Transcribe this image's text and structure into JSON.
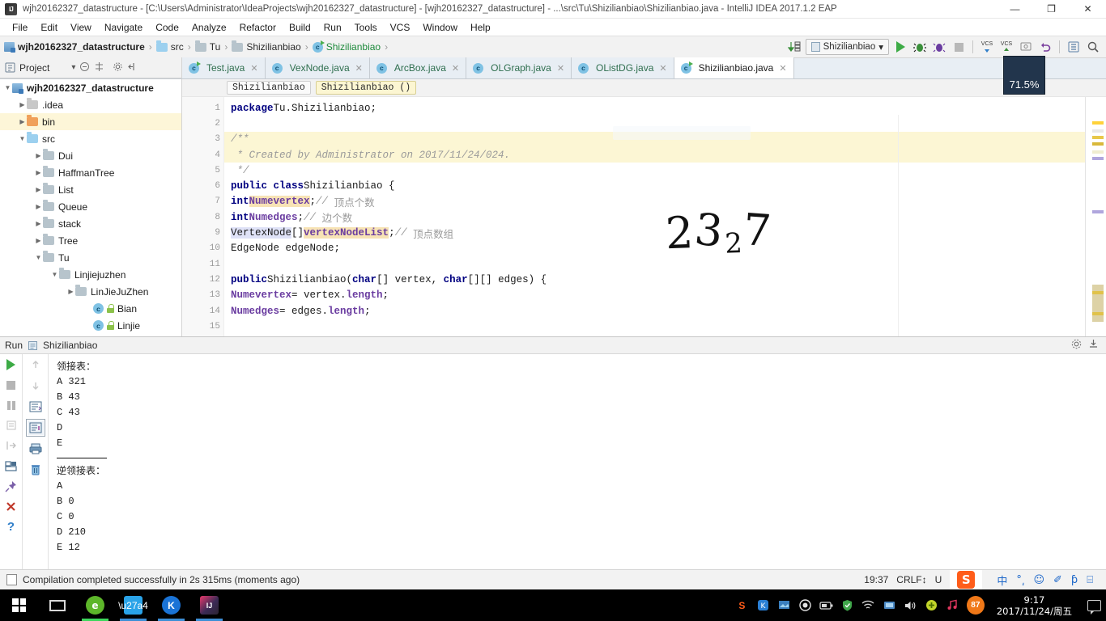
{
  "window": {
    "app_icon": "intellij-idea-icon",
    "title": "wjh20162327_datastructure - [C:\\Users\\Administrator\\IdeaProjects\\wjh20162327_datastructure] - [wjh20162327_datastructure] - ...\\src\\Tu\\Shizilianbiao\\Shizilianbiao.java - IntelliJ IDEA 2017.1.2 EAP",
    "minimize": "—",
    "maximize": "❐",
    "close": "✕"
  },
  "menu": {
    "items": [
      "File",
      "Edit",
      "View",
      "Navigate",
      "Code",
      "Analyze",
      "Refactor",
      "Build",
      "Run",
      "Tools",
      "VCS",
      "Window",
      "Help"
    ]
  },
  "breadcrumb": {
    "items": [
      {
        "label": "wjh20162327_datastructure",
        "icon": "module-icon"
      },
      {
        "label": "src",
        "icon": "source-folder-icon"
      },
      {
        "label": "Tu",
        "icon": "package-icon"
      },
      {
        "label": "Shizilianbiao",
        "icon": "package-icon"
      },
      {
        "label": "Shizilianbiao",
        "icon": "java-class-icon"
      }
    ],
    "separator": "›"
  },
  "toolbar": {
    "update_icon": "update-project-icon",
    "run_config": "Shizilianbiao",
    "run_config_dropdown": "▾",
    "run_button": "run-button",
    "debug_button": "debug-button",
    "coverage_button": "run-with-coverage-button",
    "stop_button": "stop-button",
    "vcs_update_label": "VCS",
    "vcs_commit_label": "VCS",
    "history_icon": "vcs-history-icon",
    "undo_icon": "undo-icon",
    "struct_icon": "structure-icon",
    "search_icon": "search-everywhere-icon"
  },
  "project_panel": {
    "title": "Project",
    "dropdown": "▾",
    "collapse_icon": "collapse-all-icon",
    "target_icon": "scroll-from-source-icon",
    "settings_icon": "gear-icon",
    "hide_icon": "hide-panel-icon",
    "tree": [
      {
        "label": "wjh20162327_datastructure",
        "indent": 0,
        "arrow": "down",
        "icon": "module-icon",
        "bold": true,
        "highlight": false
      },
      {
        "label": ".idea",
        "indent": 1,
        "arrow": "right",
        "icon": "folder-grey-icon",
        "bold": false,
        "highlight": false
      },
      {
        "label": "bin",
        "indent": 1,
        "arrow": "right",
        "icon": "folder-bin-icon",
        "bold": false,
        "highlight": true
      },
      {
        "label": "src",
        "indent": 1,
        "arrow": "down",
        "icon": "source-folder-icon",
        "bold": false,
        "highlight": false
      },
      {
        "label": "Dui",
        "indent": 2,
        "arrow": "right",
        "icon": "package-icon",
        "bold": false,
        "highlight": false
      },
      {
        "label": "HaffmanTree",
        "indent": 2,
        "arrow": "right",
        "icon": "package-icon",
        "bold": false,
        "highlight": false
      },
      {
        "label": "List",
        "indent": 2,
        "arrow": "right",
        "icon": "package-icon",
        "bold": false,
        "highlight": false
      },
      {
        "label": "Queue",
        "indent": 2,
        "arrow": "right",
        "icon": "package-icon",
        "bold": false,
        "highlight": false
      },
      {
        "label": "stack",
        "indent": 2,
        "arrow": "right",
        "icon": "package-icon",
        "bold": false,
        "highlight": false
      },
      {
        "label": "Tree",
        "indent": 2,
        "arrow": "right",
        "icon": "package-icon",
        "bold": false,
        "highlight": false
      },
      {
        "label": "Tu",
        "indent": 2,
        "arrow": "down",
        "icon": "package-icon",
        "bold": false,
        "highlight": false
      },
      {
        "label": "Linjiejuzhen",
        "indent": 3,
        "arrow": "down",
        "icon": "package-icon",
        "bold": false,
        "highlight": false
      },
      {
        "label": "LinJieJuZhen",
        "indent": 4,
        "arrow": "right",
        "icon": "package-icon",
        "bold": false,
        "highlight": false
      },
      {
        "label": "Bian",
        "indent": 5,
        "arrow": "none",
        "icon": "java-class-icon",
        "bold": false,
        "highlight": false
      },
      {
        "label": "Linjie",
        "indent": 5,
        "arrow": "none",
        "icon": "java-class-icon",
        "bold": false,
        "highlight": false
      }
    ]
  },
  "editor_tabs": [
    {
      "label": "Test.java",
      "active": false,
      "icon": "java-runnable-class-icon"
    },
    {
      "label": "VexNode.java",
      "active": false,
      "icon": "java-class-icon"
    },
    {
      "label": "ArcBox.java",
      "active": false,
      "icon": "java-class-icon"
    },
    {
      "label": "OLGraph.java",
      "active": false,
      "icon": "java-class-icon"
    },
    {
      "label": "OListDG.java",
      "active": false,
      "icon": "java-class-icon"
    },
    {
      "label": "Shizilianbiao.java",
      "active": true,
      "icon": "java-runnable-class-icon"
    }
  ],
  "editor": {
    "breadcrumb_chips": [
      {
        "label": "Shizilianbiao",
        "selected": false
      },
      {
        "label": "Shizilianbiao ()",
        "selected": true
      }
    ],
    "line_numbers": [
      "1",
      "2",
      "3",
      "4",
      "5",
      "6",
      "7",
      "8",
      "9",
      "10",
      "11",
      "12",
      "13",
      "14",
      "15"
    ],
    "code_lines": [
      {
        "n": "1",
        "html": "<span class=\"kw\">package</span> <span class=\"ident\">Tu.Shizilianbiao;</span>",
        "comment_bg": false
      },
      {
        "n": "2",
        "html": "",
        "comment_bg": false
      },
      {
        "n": "3",
        "html": "<span class=\"cm\">/**</span>",
        "comment_bg": true
      },
      {
        "n": "4",
        "html": "<span class=\"cm\"> * Created by Administrator on 2017/11/24/024.</span>",
        "comment_bg": true
      },
      {
        "n": "5",
        "html": "<span class=\"cm\"> */</span>",
        "comment_bg": false
      },
      {
        "n": "6",
        "html": "<span class=\"kw\">public class</span> <span class=\"ident\">Shizilianbiao {</span>",
        "comment_bg": false
      },
      {
        "n": "7",
        "html": "    <span class=\"kw\">int</span> <span class=\"fldhl\">Numevertex</span><span class=\"ident\">;</span> <span class=\"cm\">// </span><span class=\"cmcn\">顶点个数</span>",
        "comment_bg": false
      },
      {
        "n": "8",
        "html": "    <span class=\"kw\">int</span> <span class=\"fld\">Numedges</span><span class=\"ident\">;</span> <span class=\"cm\">// </span><span class=\"cmcn\">边个数</span>",
        "comment_bg": false
      },
      {
        "n": "9",
        "html": "    <span class=\"typehl\">VertexNode</span><span class=\"ident\">[]</span> <span class=\"fldhl\">vertexNodeList</span><span class=\"ident\">;</span> <span class=\"cm\">// </span><span class=\"cmcn\">顶点数组</span>",
        "comment_bg": false
      },
      {
        "n": "10",
        "html": "    <span class=\"ident\">EdgeNode edgeNode;</span>",
        "comment_bg": false
      },
      {
        "n": "11",
        "html": "",
        "comment_bg": false
      },
      {
        "n": "12",
        "html": "    <span class=\"kw\">public</span> <span class=\"ident\">Shizilianbiao(</span><span class=\"kw\">char</span><span class=\"ident\">[] vertex, </span><span class=\"kw\">char</span><span class=\"ident\">[][] edges) {</span>",
        "comment_bg": false
      },
      {
        "n": "13",
        "html": "        <span class=\"fld\">Numevertex</span> <span class=\"ident\">= vertex.</span><span class=\"fld\">length</span><span class=\"ident\">;</span>",
        "comment_bg": false
      },
      {
        "n": "14",
        "html": "        <span class=\"fld\">Numedges</span> <span class=\"ident\">= edges.</span><span class=\"fld\">length</span><span class=\"ident\">;</span>",
        "comment_bg": false
      },
      {
        "n": "15",
        "html": "",
        "comment_bg": false
      }
    ],
    "handwritten_annotation": "2327",
    "zoom_badge": "71.5%"
  },
  "run_panel": {
    "title": "Run",
    "config_name": "Shizilianbiao",
    "settings_icon": "gear-icon",
    "hide_icon": "hide-panel-icon",
    "left_tools": [
      {
        "icon": "rerun-icon",
        "name": "rerun-button"
      },
      {
        "icon": "stop-icon",
        "name": "stop-button"
      },
      {
        "icon": "pause-icon",
        "name": "pause-button"
      },
      {
        "icon": "dump-threads-icon",
        "name": "dump-threads-button"
      },
      {
        "icon": "resume-icon",
        "name": "resume-button"
      },
      {
        "icon": "layout-icon",
        "name": "restore-layout-button"
      },
      {
        "icon": "pin-icon",
        "name": "pin-tab-button"
      },
      {
        "icon": "close-icon",
        "name": "close-button"
      },
      {
        "icon": "help-icon",
        "name": "help-button"
      }
    ],
    "right_tools": [
      {
        "icon": "up-arrow-icon",
        "name": "previous-occurrence-button"
      },
      {
        "icon": "down-arrow-icon",
        "name": "next-occurrence-button"
      },
      {
        "icon": "soft-wrap-icon",
        "name": "soft-wrap-button"
      },
      {
        "icon": "scroll-end-icon",
        "name": "scroll-to-end-button"
      },
      {
        "icon": "print-icon",
        "name": "print-button"
      },
      {
        "icon": "trash-icon",
        "name": "clear-all-button"
      }
    ],
    "console_output": [
      {
        "text": "领接表：",
        "cn": true
      },
      {
        "text": "A 321",
        "cn": false
      },
      {
        "text": "B 43",
        "cn": false
      },
      {
        "text": "C 43",
        "cn": false
      },
      {
        "text": "D",
        "cn": false
      },
      {
        "text": "E",
        "cn": false
      },
      {
        "text": "__RULE__",
        "cn": false
      },
      {
        "text": "逆领接表：",
        "cn": true
      },
      {
        "text": "A",
        "cn": false
      },
      {
        "text": "B 0",
        "cn": false
      },
      {
        "text": "C 0",
        "cn": false
      },
      {
        "text": "D 210",
        "cn": false
      },
      {
        "text": "E 12",
        "cn": false
      }
    ]
  },
  "status_bar": {
    "message": "Compilation completed successfully in 2s 315ms (moments ago)",
    "time": "19:37",
    "line_separator": "CRLF↕",
    "encoding": "U",
    "ime_logo": "S",
    "ime_items": [
      "中",
      "°͵",
      "☺",
      "✐",
      "ƥ",
      "⌸"
    ]
  },
  "taskbar": {
    "start_icon": "windows-start-icon",
    "task_view_icon": "task-view-icon",
    "apps": [
      {
        "icon": "browser-360-icon",
        "name": "taskbar-app-360browser",
        "open": true,
        "color": "#5db62a",
        "glyph": "e"
      },
      {
        "icon": "foxmail-icon",
        "name": "taskbar-app-foxmail",
        "open": true,
        "color": "#2aa3e8",
        "glyph": "➤"
      },
      {
        "icon": "kingsoft-icon",
        "name": "taskbar-app-kingsoft",
        "open": true,
        "color": "#1a73d6",
        "glyph": "K"
      },
      {
        "icon": "intellij-idea-icon",
        "name": "taskbar-app-intellij",
        "open": true,
        "color": "#2d2433",
        "glyph": "IJ"
      }
    ],
    "tray": [
      "sogou-icon",
      "kingsoft-icon",
      "display-icon",
      "record-icon",
      "battery-icon",
      "shield-icon",
      "wifi-icon",
      "network-icon",
      "volume-icon",
      "plus-icon",
      "music-icon"
    ],
    "battery_badge": "87",
    "clock_time": "9:17",
    "clock_date": "2017/11/24/周五",
    "notification_icon": "notification-icon"
  }
}
